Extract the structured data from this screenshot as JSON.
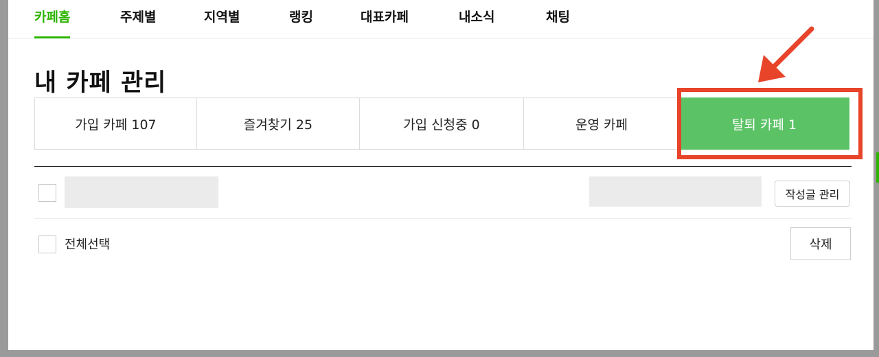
{
  "nav": {
    "items": [
      {
        "label": "카페홈",
        "active": true
      },
      {
        "label": "주제별",
        "active": false
      },
      {
        "label": "지역별",
        "active": false
      },
      {
        "label": "랭킹",
        "active": false
      },
      {
        "label": "대표카페",
        "active": false
      },
      {
        "label": "내소식",
        "active": false
      },
      {
        "label": "채팅",
        "active": false
      }
    ]
  },
  "page": {
    "title": "내 카페 관리"
  },
  "tabs": [
    {
      "label": "가입 카페 107",
      "selected": false
    },
    {
      "label": "즐겨찾기 25",
      "selected": false
    },
    {
      "label": "가입 신청중 0",
      "selected": false
    },
    {
      "label": "운영 카페",
      "selected": false
    },
    {
      "label": "탈퇴 카페 1",
      "selected": true
    }
  ],
  "list": {
    "manage_posts_label": "작성글 관리",
    "select_all_label": "전체선택",
    "delete_label": "삭제"
  },
  "colors": {
    "brand_green": "#2db400",
    "selected_tab": "#5bc266",
    "annotation_red": "#e8442a"
  }
}
